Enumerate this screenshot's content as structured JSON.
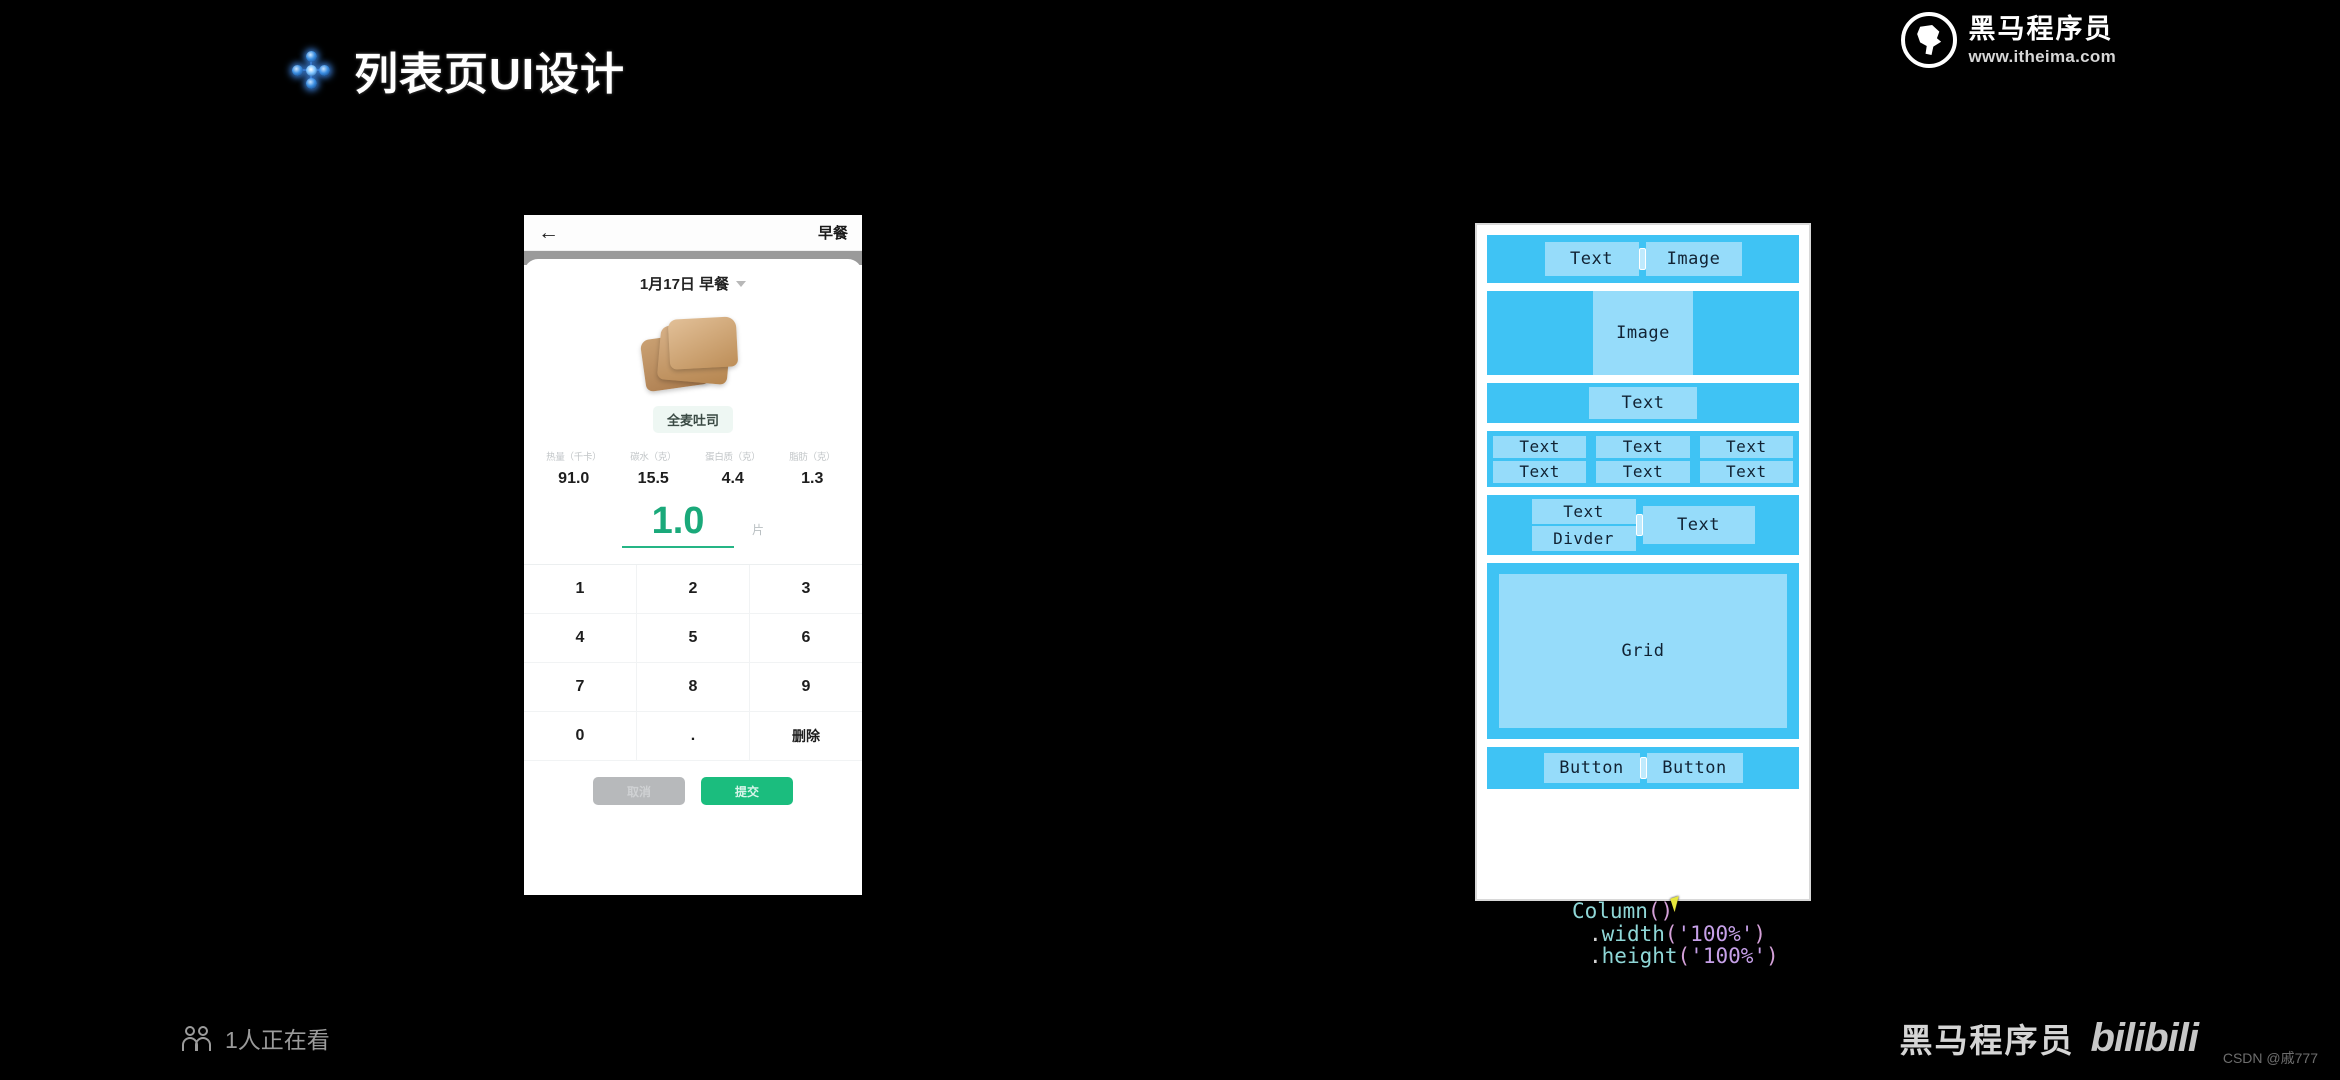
{
  "slide": {
    "title": "列表页UI设计",
    "title_icon": "four-diamond-icon"
  },
  "brand_logo": {
    "icon": "itheima-horse-logo-icon",
    "name_cn": "黑马程序员",
    "url": "www.itheima.com"
  },
  "phone_mockup": {
    "statusbar": {
      "back_icon": "back-arrow-icon",
      "title": "早餐"
    },
    "sheet": {
      "date_label": "1月17日 早餐",
      "dropdown_icon": "chevron-down-icon",
      "food_image_icon": "toast-bread-image",
      "food_name": "全麦吐司"
    },
    "nutrition": {
      "labels": [
        "热量（千卡）",
        "碳水（克）",
        "蛋白质（克）",
        "脂肪（克）"
      ],
      "values": [
        "91.0",
        "15.5",
        "4.4",
        "1.3"
      ]
    },
    "amount": {
      "value": "1.0",
      "unit": "片",
      "accent_color": "#1aa97a"
    },
    "keypad": {
      "rows": [
        [
          "1",
          "2",
          "3"
        ],
        [
          "4",
          "5",
          "6"
        ],
        [
          "7",
          "8",
          "9"
        ],
        [
          "0",
          ".",
          "删除"
        ]
      ]
    },
    "actions": {
      "cancel_label": "取消",
      "submit_label": "提交",
      "submit_color": "#1bbd7e",
      "cancel_color": "#b7b9bb"
    }
  },
  "wireframe": {
    "band_color": "#3fc3f4",
    "block_color": "#96dcfa",
    "rows": {
      "row1": [
        "Text",
        "Image"
      ],
      "row2": [
        "Image"
      ],
      "row3": [
        "Text"
      ],
      "row4": [
        [
          "Text",
          "Text"
        ],
        [
          "Text",
          "Text"
        ],
        [
          "Text",
          "Text"
        ]
      ],
      "row5": {
        "stack": [
          "Text",
          "Divder"
        ],
        "right": "Text"
      },
      "row6": [
        "Grid"
      ],
      "row7": [
        "Button",
        "Button"
      ]
    }
  },
  "code_snippet": {
    "line1_class": "Column",
    "line1_parens": "()",
    "line2_dot": ".",
    "line2_fn": "width",
    "line2_arg": "'100%'",
    "line3_dot": ".",
    "line3_fn": "height",
    "line3_arg": "'100%'",
    "open_paren": "(",
    "close_paren": ")"
  },
  "overlays": {
    "viewers_icon": "people-icon",
    "viewers_text": "1人正在看",
    "watermark_cn": "黑马程序员",
    "watermark_platform": "bilibili",
    "csdn_credit": "CSDN @戚777"
  }
}
